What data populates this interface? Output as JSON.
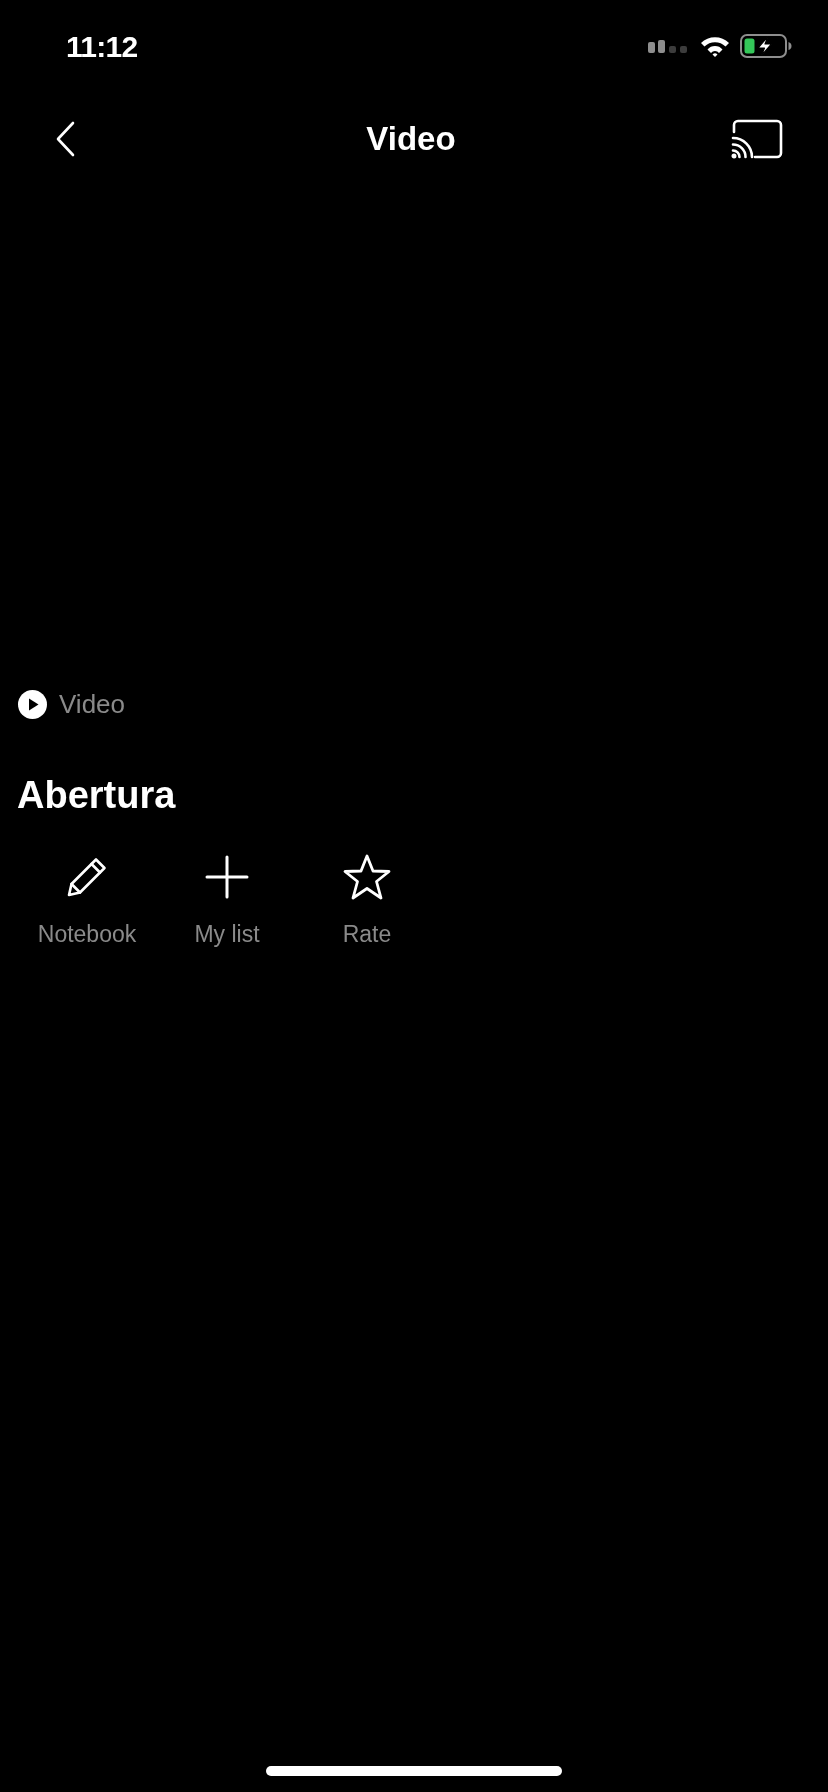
{
  "status_bar": {
    "time": "11:12"
  },
  "header": {
    "title": "Video"
  },
  "media": {
    "type_label": "Video",
    "title": "Abertura"
  },
  "actions": [
    {
      "kind": "notebook",
      "label": "Notebook"
    },
    {
      "kind": "add",
      "label": "My list"
    },
    {
      "kind": "rate",
      "label": "Rate"
    }
  ]
}
